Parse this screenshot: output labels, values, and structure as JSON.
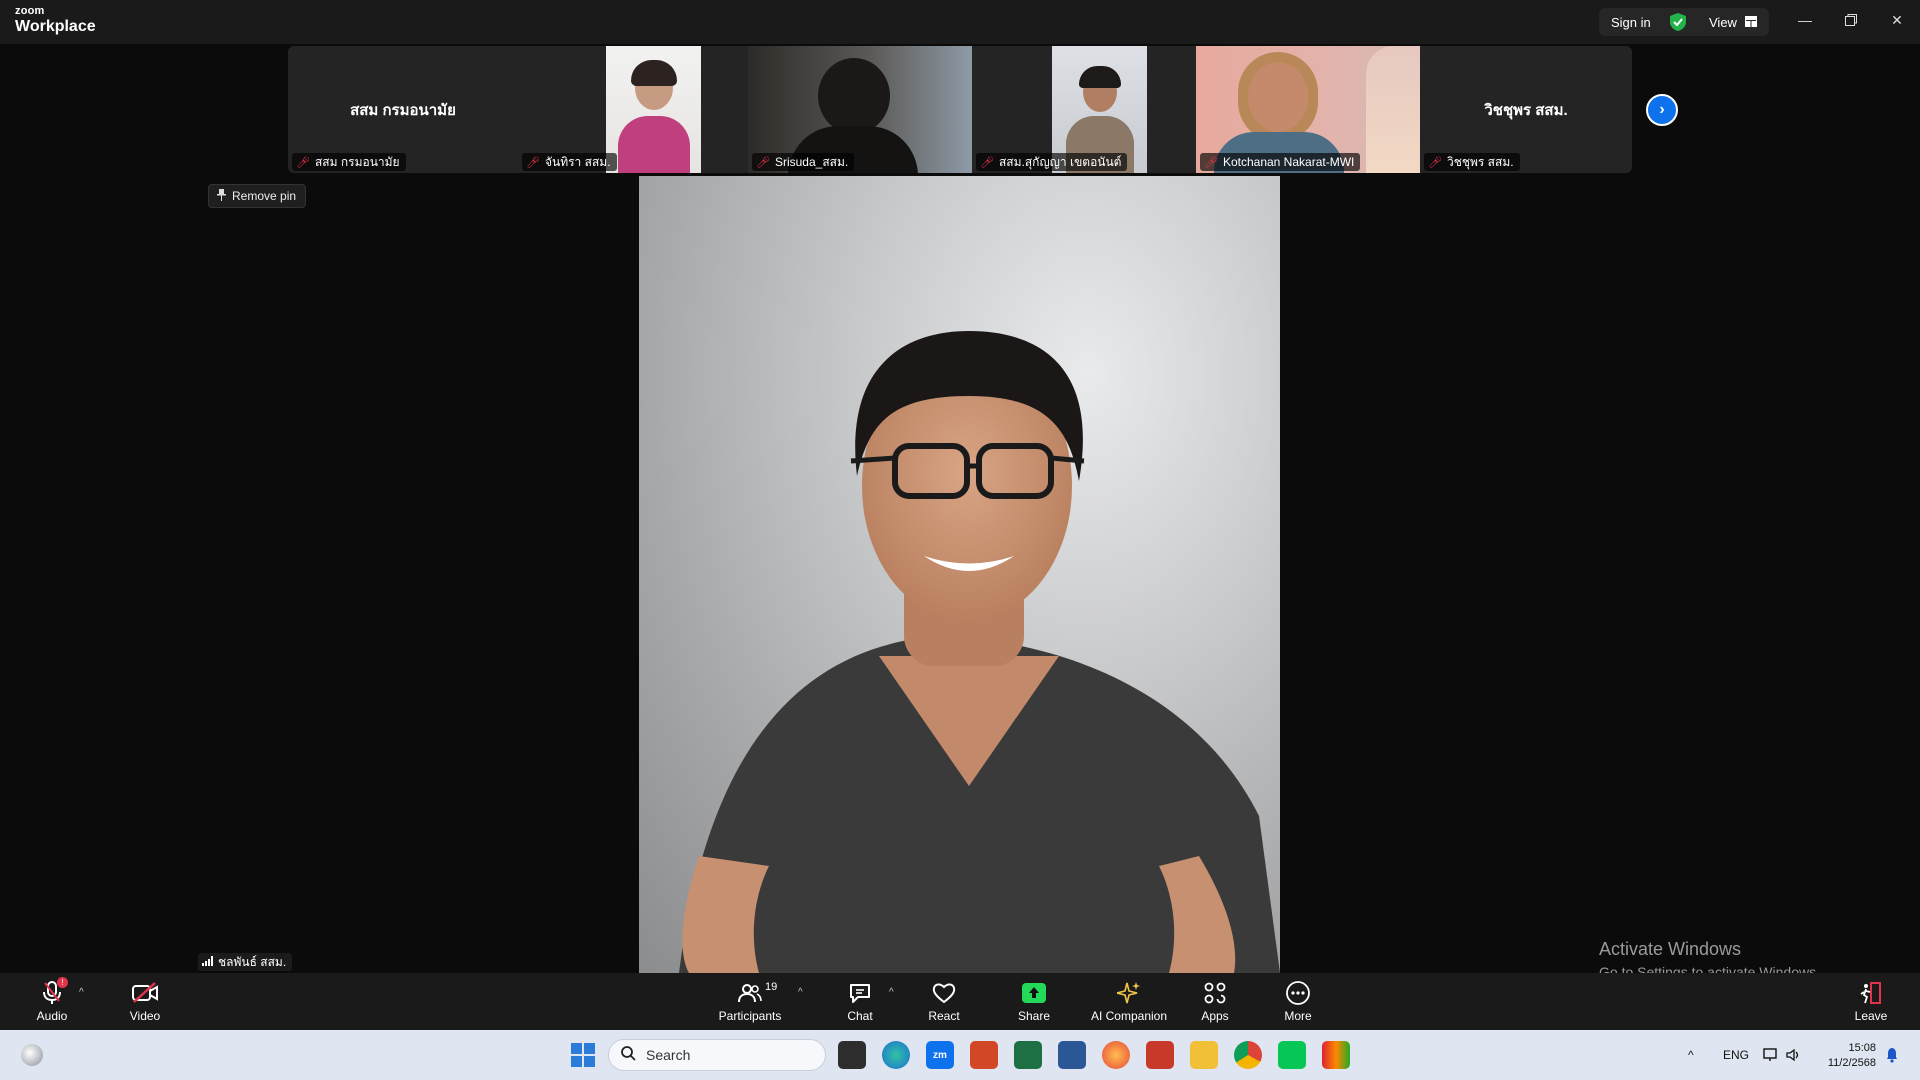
{
  "titlebar": {
    "brand_small": "zoom",
    "brand_large": "Workplace",
    "signin_label": "Sign in",
    "view_label": "View"
  },
  "thumbnails": [
    {
      "name": "สสม กรมอนามัย",
      "display_name": "สสม กรมอนามัย",
      "video": false,
      "muted": true
    },
    {
      "name": "จันทิรา สสม.",
      "video": true,
      "muted": true
    },
    {
      "name": "Srisuda_สสม.",
      "video": true,
      "muted": true
    },
    {
      "name": "สสม.สุกัญญา เขตอนันต์",
      "video": true,
      "muted": true
    },
    {
      "name": "Kotchanan Nakarat-MWI",
      "video": true,
      "muted": true
    },
    {
      "name": "วิชชุพร สสม.",
      "display_name": "วิชชุพร สสม.",
      "video": false,
      "muted": true
    }
  ],
  "remove_pin_label": "Remove pin",
  "main_speaker": {
    "name": "ชลพันธ์ สสม."
  },
  "watermark": {
    "title": "Activate Windows",
    "subtitle": "Go to Settings to activate Windows."
  },
  "toolbar": {
    "audio": "Audio",
    "video": "Video",
    "participants": "Participants",
    "participant_count": "19",
    "chat": "Chat",
    "react": "React",
    "share": "Share",
    "ai_companion": "AI Companion",
    "apps": "Apps",
    "more": "More",
    "leave": "Leave"
  },
  "taskbar": {
    "search_placeholder": "Search",
    "language": "ENG",
    "time": "15:08",
    "date": "11/2/2568"
  },
  "colors": {
    "accent_blue": "#0e72ed",
    "share_green": "#23d959",
    "muted_red": "#e0344a"
  }
}
